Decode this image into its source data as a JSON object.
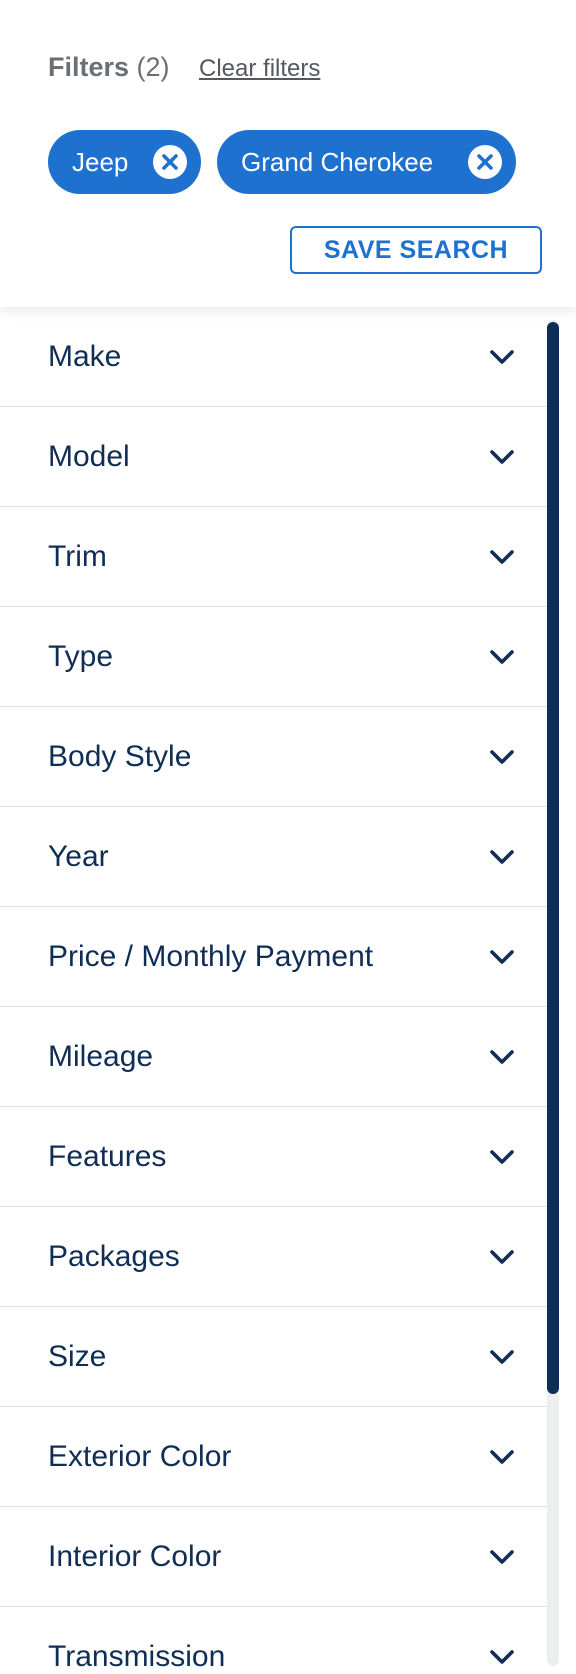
{
  "header": {
    "filters_label": "Filters",
    "filters_count": "(2)",
    "clear_label": "Clear filters",
    "chips": [
      {
        "label": "Jeep",
        "icon": "close-circle-icon"
      },
      {
        "label": "Grand Cherokee",
        "icon": "close-circle-icon"
      }
    ],
    "save_label": "SAVE SEARCH"
  },
  "filters": {
    "items": [
      {
        "label": "Make"
      },
      {
        "label": "Model"
      },
      {
        "label": "Trim"
      },
      {
        "label": "Type"
      },
      {
        "label": "Body Style"
      },
      {
        "label": "Year"
      },
      {
        "label": "Price / Monthly Payment"
      },
      {
        "label": "Mileage"
      },
      {
        "label": "Features"
      },
      {
        "label": "Packages"
      },
      {
        "label": "Size"
      },
      {
        "label": "Exterior Color"
      },
      {
        "label": "Interior Color"
      },
      {
        "label": "Transmission"
      }
    ],
    "expand_icon": "chevron-down-icon"
  },
  "colors": {
    "accent": "#1f71d0",
    "text_dark": "#0f2d55",
    "scroll_thumb": "#0d2e57"
  }
}
